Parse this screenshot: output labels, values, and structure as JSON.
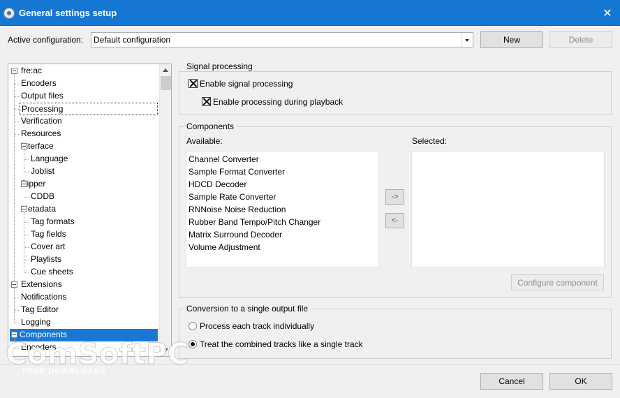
{
  "window": {
    "title": "General settings setup",
    "close_icon": "close-icon",
    "app_icon": "freac-icon"
  },
  "config": {
    "label": "Active configuration:",
    "value": "Default configuration",
    "new_label": "New",
    "delete_label": "Delete"
  },
  "tree": {
    "items": [
      {
        "label": "fre:ac"
      },
      {
        "label": "Encoders"
      },
      {
        "label": "Output files"
      },
      {
        "label": "Processing"
      },
      {
        "label": "Verification"
      },
      {
        "label": "Resources"
      },
      {
        "label": "Interface"
      },
      {
        "label": "Language"
      },
      {
        "label": "Joblist"
      },
      {
        "label": "Ripper"
      },
      {
        "label": "CDDB"
      },
      {
        "label": "Metadata"
      },
      {
        "label": "Tag formats"
      },
      {
        "label": "Tag fields"
      },
      {
        "label": "Cover art"
      },
      {
        "label": "Playlists"
      },
      {
        "label": "Cue sheets"
      },
      {
        "label": "Extensions"
      },
      {
        "label": "Notifications"
      },
      {
        "label": "Tag Editor"
      },
      {
        "label": "Logging"
      },
      {
        "label": "Components"
      },
      {
        "label": "Encoders"
      }
    ],
    "selected": "Components",
    "focused": "Processing"
  },
  "signal": {
    "title": "Signal processing",
    "enable_label": "Enable signal processing",
    "enable_checked": true,
    "playback_label": "Enable processing during playback",
    "playback_checked": true
  },
  "components": {
    "title": "Components",
    "available_label": "Available:",
    "selected_label": "Selected:",
    "available": [
      "Channel Converter",
      "Sample Format Converter",
      "HDCD Decoder",
      "Sample Rate Converter",
      "RNNoise Noise Reduction",
      "Rubber Band Tempo/Pitch Changer",
      "Matrix Surround Decoder",
      "Volume Adjustment"
    ],
    "selected": [],
    "add_label": "->",
    "remove_label": "<-",
    "configure_label": "Configure component"
  },
  "conversion": {
    "title": "Conversion to a single output file",
    "option1": "Process each track individually",
    "option2": "Treat the combined tracks like a single track",
    "selected_option": "option2"
  },
  "footer": {
    "cancel_label": "Cancel",
    "ok_label": "OK"
  },
  "watermark": {
    "text": "ComSoftPC",
    "sub": "FREE DOWNLOADS"
  }
}
